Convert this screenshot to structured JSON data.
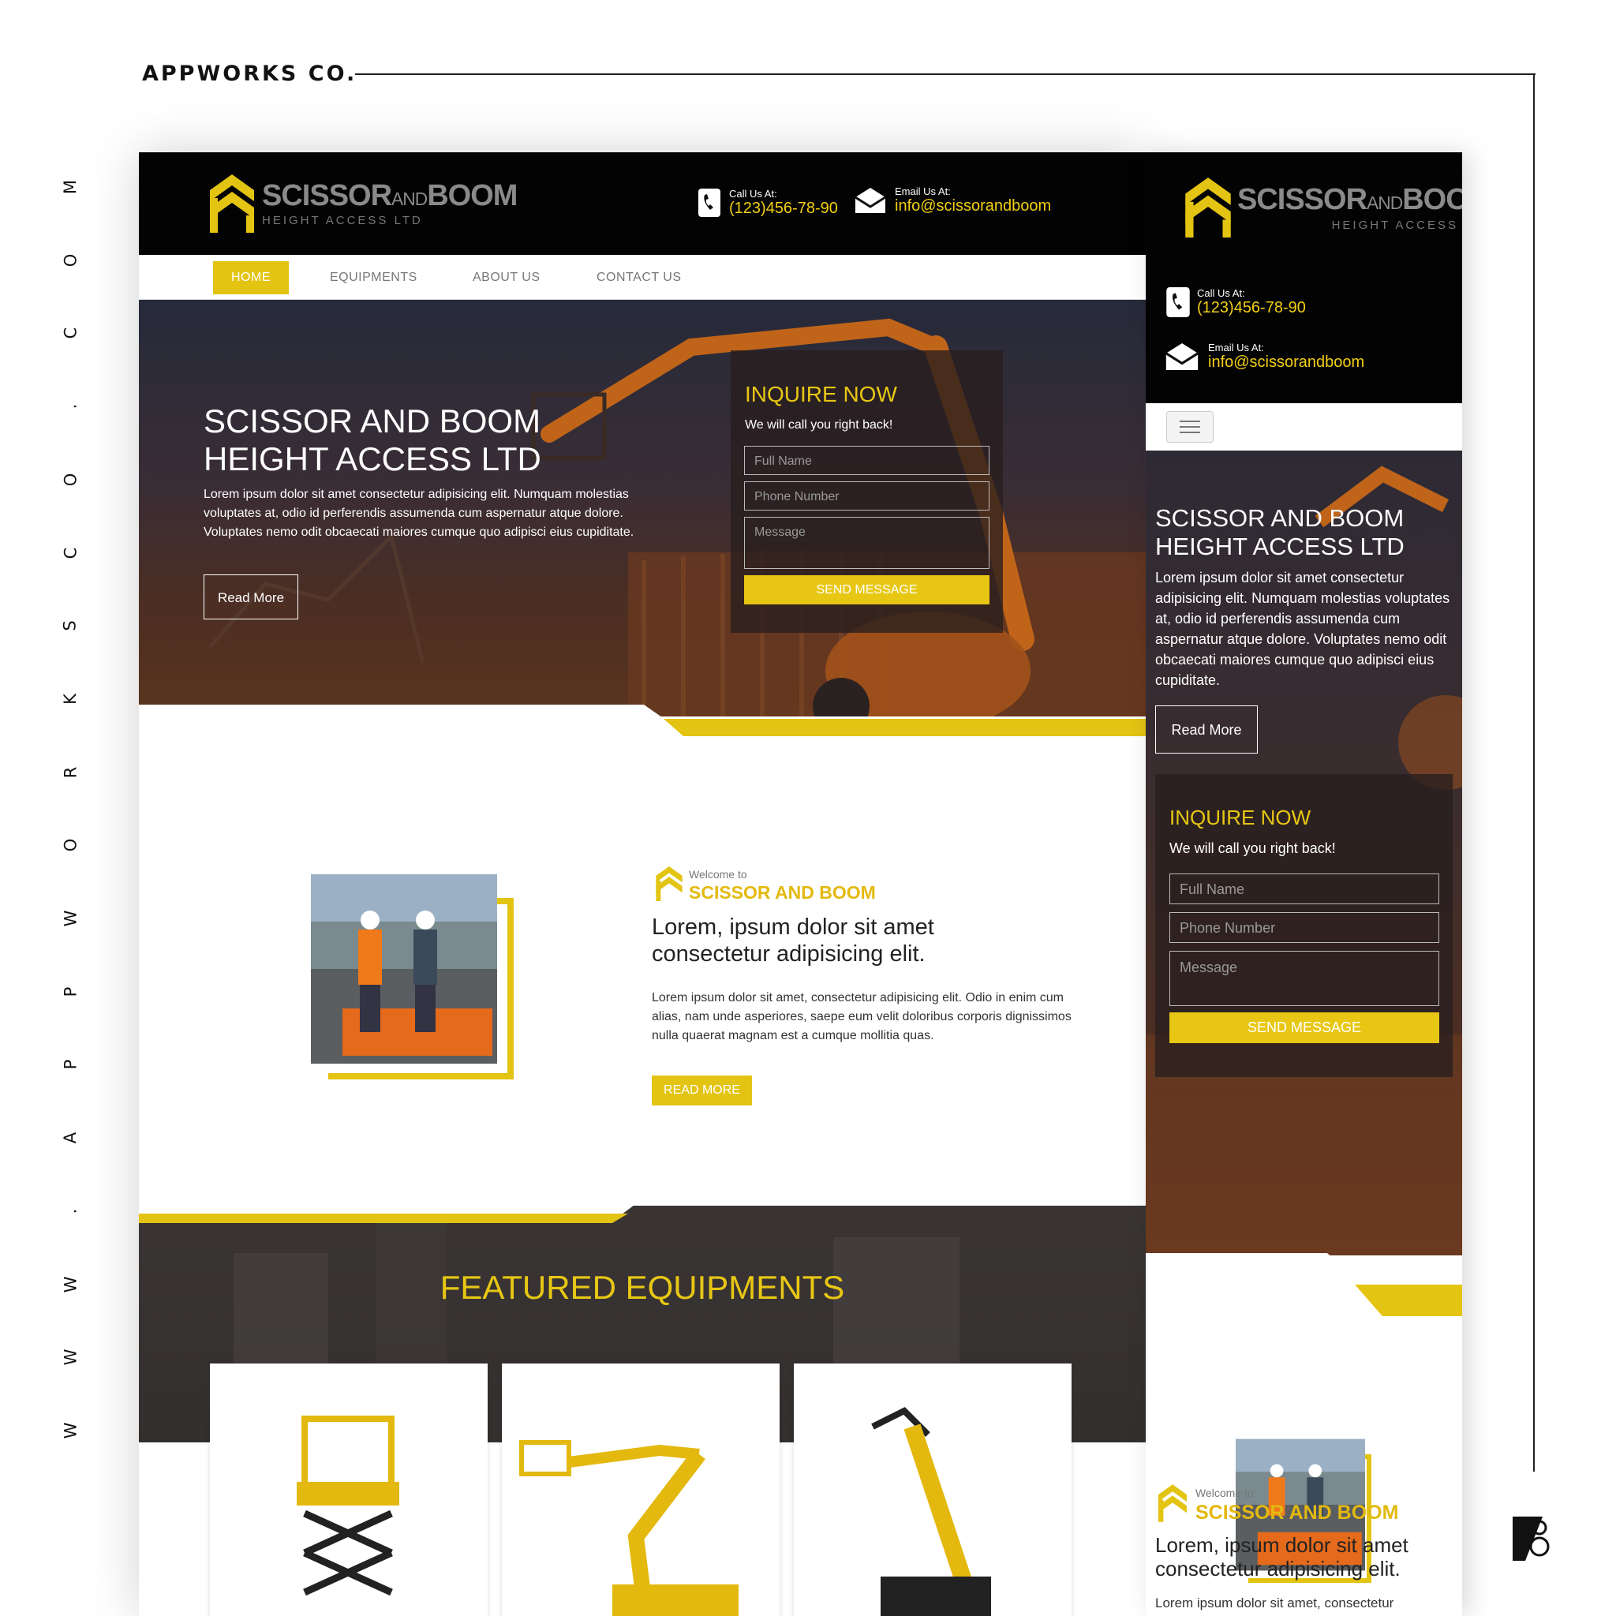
{
  "frame": {
    "brand": "APPWORKS CO.",
    "vertical_url": [
      "W",
      "W",
      "W",
      ".",
      "A",
      "P",
      "P",
      "W",
      "O",
      "R",
      "K",
      "S",
      "C",
      "O",
      ".",
      "C",
      "O",
      "M"
    ]
  },
  "colors": {
    "accent": "#e3c413",
    "dark": "#030303",
    "text_gray": "#777777"
  },
  "site": {
    "logo": {
      "name_main": "SCISSOR",
      "name_and": "AND",
      "name_end": "BOOM",
      "tagline": "HEIGHT ACCESS LTD"
    },
    "contact": {
      "call_label": "Call Us At:",
      "phone": "(123)456-78-90",
      "email_label": "Email Us At:",
      "email": "info@scissorandboom"
    },
    "nav": [
      "HOME",
      "EQUIPMENTS",
      "ABOUT US",
      "CONTACT US"
    ],
    "hero": {
      "title_line1": "SCISSOR AND BOOM",
      "title_line2": "HEIGHT ACCESS LTD",
      "text": "Lorem ipsum dolor sit amet consectetur adipisicing elit. Numquam molestias voluptates at, odio id perferendis assumenda cum aspernatur atque dolore. Voluptates nemo odit obcaecati maiores cumque quo adipisci eius cupiditate.",
      "button": "Read More"
    },
    "form": {
      "title": "INQUIRE NOW",
      "subtitle": "We will call you right back!",
      "fullname_placeholder": "Full Name",
      "phone_placeholder": "Phone Number",
      "message_placeholder": "Message",
      "send": "SEND MESSAGE"
    },
    "about": {
      "welcome_small": "Welcome to",
      "welcome_big": "SCISSOR AND BOOM",
      "heading": "Lorem, ipsum dolor sit amet consectetur adipisicing elit.",
      "text": "Lorem ipsum dolor sit amet, consectetur adipisicing elit. Odio in enim cum alias, nam unde asperiores, saepe eum velit doloribus corporis dignissimos nulla quaerat magnam est a cumque mollitia quas.",
      "button": "READ MORE",
      "mobile_text_start": "Lorem ipsum dolor sit amet, consectetur"
    },
    "featured": {
      "title": "FEATURED EQUIPMENTS"
    },
    "icons": [
      "phone-icon",
      "mail-icon",
      "hamburger-menu-icon",
      "logo-chevron-icon"
    ]
  }
}
